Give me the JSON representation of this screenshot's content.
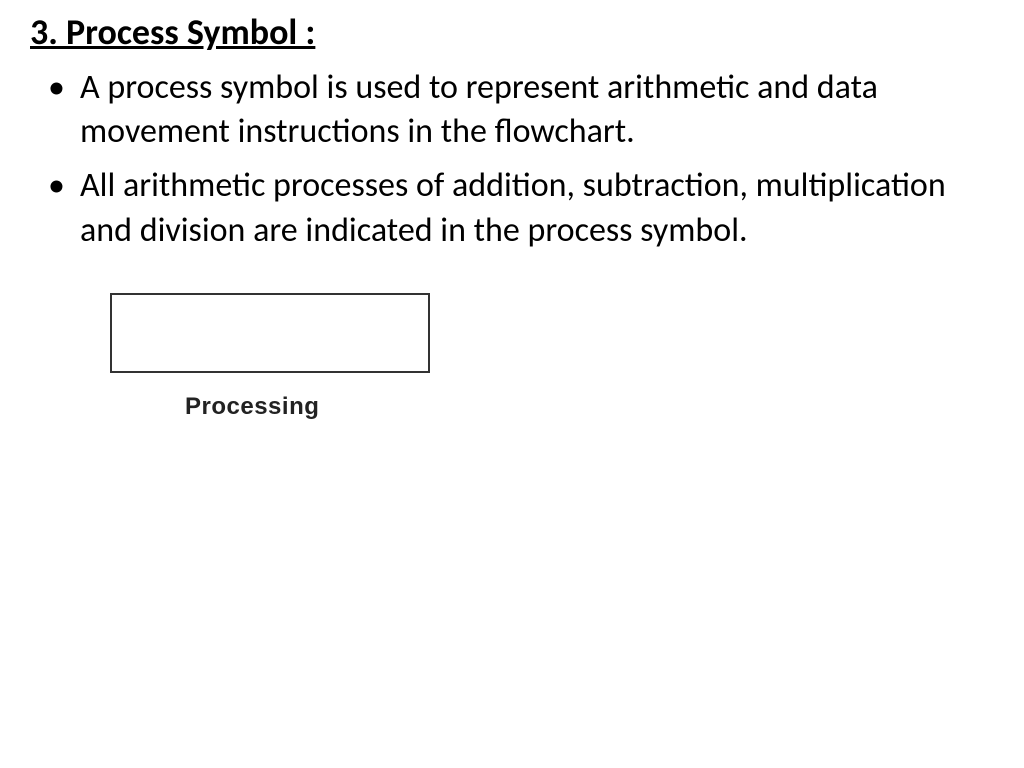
{
  "heading": "3. Process Symbol :",
  "bullets": [
    "A process symbol is used to represent arithmetic and data movement instructions in the flowchart.",
    "All arithmetic processes of addition, subtraction, multiplication and division are indicated in the process symbol."
  ],
  "diagram": {
    "label": "Processing"
  }
}
